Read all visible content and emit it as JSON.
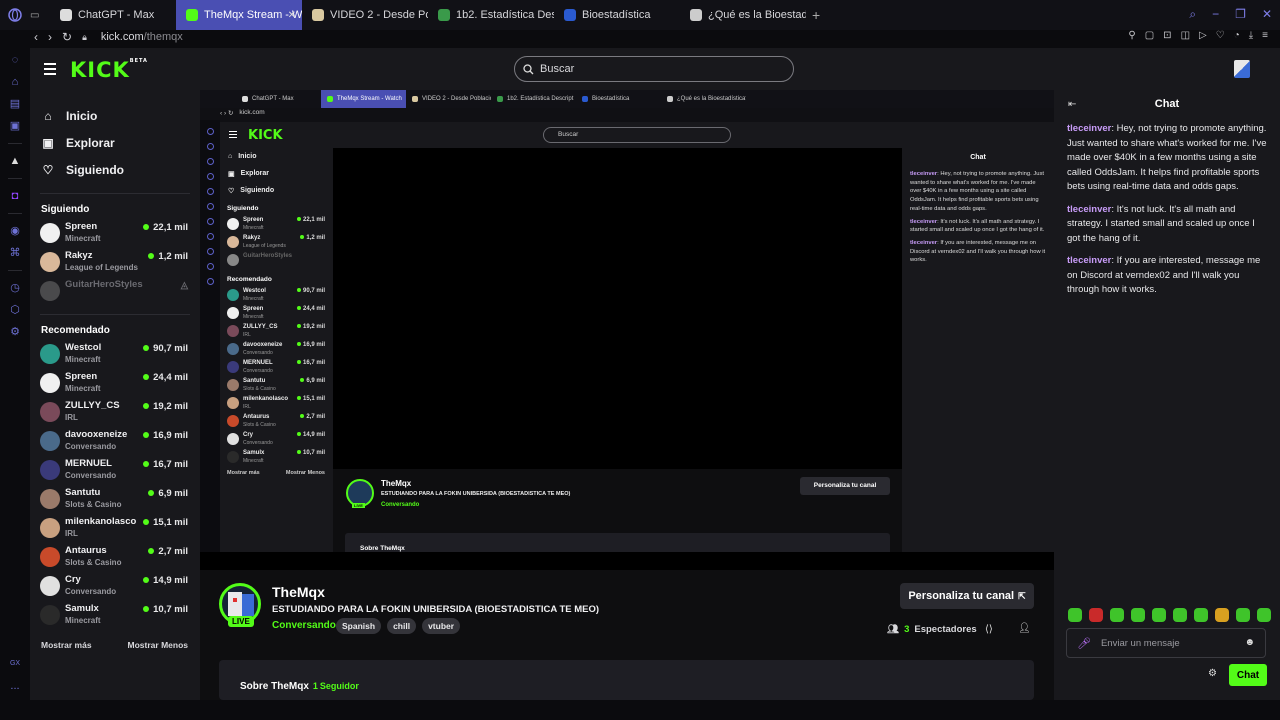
{
  "browser": {
    "tabs": [
      {
        "label": "ChatGPT - Max",
        "icon": "chatgpt-icon",
        "active": false
      },
      {
        "label": "TheMqx Stream - Watch",
        "icon": "kick-icon",
        "active": true
      },
      {
        "label": "VIDEO 2 - Desde Poblacio",
        "icon": "video-icon",
        "active": false
      },
      {
        "label": "1b2. Estadística Descript",
        "icon": "drive-icon",
        "active": false
      },
      {
        "label": "Bioestadística",
        "icon": "word-icon",
        "active": false
      },
      {
        "label": "¿Qué es la Bioestadística?",
        "icon": "web-icon",
        "active": false
      }
    ],
    "new_tab": "+",
    "url_host": "kick.com",
    "url_path": "/themqx"
  },
  "kick": {
    "logo": "KICK",
    "logo_badge": "BETA",
    "search_placeholder": "Buscar",
    "nav": [
      {
        "label": "Inicio",
        "icon": "home-icon"
      },
      {
        "label": "Explorar",
        "icon": "browse-icon"
      },
      {
        "label": "Siguiendo",
        "icon": "heart-icon"
      }
    ],
    "following_heading": "Siguiendo",
    "following": [
      {
        "name": "Spreen",
        "game": "Minecraft",
        "viewers": "22,1 mil",
        "live": true,
        "color": "#f0f0f0"
      },
      {
        "name": "Rakyz",
        "game": "League of Legends",
        "viewers": "1,2 mil",
        "live": true,
        "color": "#d9b89a"
      },
      {
        "name": "GuitarHeroStyles",
        "game": "",
        "viewers": "",
        "live": false,
        "color": "#888888"
      }
    ],
    "recommended_heading": "Recomendado",
    "recommended": [
      {
        "name": "Westcol",
        "game": "Minecraft",
        "viewers": "90,7 mil",
        "color": "#2a9a8a"
      },
      {
        "name": "Spreen",
        "game": "Minecraft",
        "viewers": "24,4 mil",
        "color": "#f0f0f0"
      },
      {
        "name": "ZULLYY_CS",
        "game": "IRL",
        "viewers": "19,2 mil",
        "color": "#7a4a5a"
      },
      {
        "name": "davooxeneize",
        "game": "Conversando",
        "viewers": "16,9 mil",
        "color": "#4a6a8a"
      },
      {
        "name": "MERNUEL",
        "game": "Conversando",
        "viewers": "16,7 mil",
        "color": "#3a3a7a"
      },
      {
        "name": "Santutu",
        "game": "Slots & Casino",
        "viewers": "6,9 mil",
        "color": "#9a7a6a"
      },
      {
        "name": "milenkanolasco",
        "game": "IRL",
        "viewers": "15,1 mil",
        "color": "#c8a080"
      },
      {
        "name": "Antaurus",
        "game": "Slots & Casino",
        "viewers": "2,7 mil",
        "color": "#c84a2a"
      },
      {
        "name": "Cry",
        "game": "Conversando",
        "viewers": "14,9 mil",
        "color": "#e0e0e0"
      },
      {
        "name": "Samulx",
        "game": "Minecraft",
        "viewers": "10,7 mil",
        "color": "#2a2a2a"
      }
    ],
    "show_more": "Mostrar más",
    "show_less": "Mostrar Menos"
  },
  "stream": {
    "name": "TheMqx",
    "title": "ESTUDIANDO PARA LA FOKIN UNIBERSIDA (BIOESTADISTICA TE MEO)",
    "category": "Conversando",
    "tags": [
      "Spanish",
      "chill",
      "vtuber"
    ],
    "live_badge": "LIVE",
    "customize_label": "Personaliza tu canal",
    "viewers_count": "3",
    "viewers_label": "Espectadores",
    "about_label": "Sobre TheMqx",
    "followers_count": "1",
    "followers_label": "Seguidor"
  },
  "chat": {
    "title": "Chat",
    "messages": [
      {
        "user": "tleceinver",
        "text": "Hey, not trying to promote anything. Just wanted to share what's worked for me. I've made over $40K in a few months using a site called OddsJam. It helps find profitable sports bets using real-time data and odds gaps."
      },
      {
        "user": "tleceinver",
        "text": "It's not luck. It's all math and strategy. I started small and scaled up once I got the hang of it."
      },
      {
        "user": "tleceinver",
        "text": "If you are interested, message me on Discord at verndex02 and I'll walk you through how it works."
      }
    ],
    "input_placeholder": "Enviar un mensaje",
    "send_label": "Chat"
  },
  "opera_sidebar": {
    "gx_label": "GX",
    "more_label": "..."
  }
}
